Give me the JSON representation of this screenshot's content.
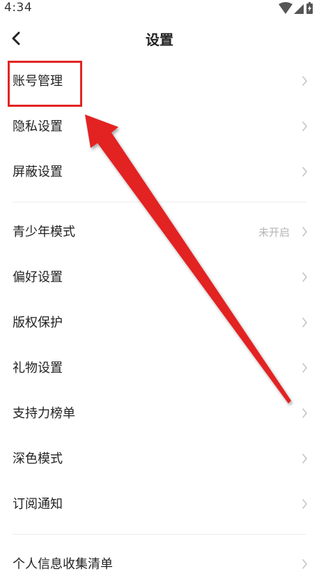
{
  "status_bar": {
    "time": "4:34"
  },
  "header": {
    "title": "设置"
  },
  "settings": {
    "group1": [
      {
        "label": "账号管理"
      },
      {
        "label": "隐私设置"
      },
      {
        "label": "屏蔽设置"
      }
    ],
    "group2": [
      {
        "label": "青少年模式",
        "value": "未开启"
      },
      {
        "label": "偏好设置"
      },
      {
        "label": "版权保护"
      },
      {
        "label": "礼物设置"
      },
      {
        "label": "支持力榜单"
      },
      {
        "label": "深色模式"
      },
      {
        "label": "订阅通知"
      }
    ],
    "group3": [
      {
        "label": "个人信息收集清单"
      }
    ]
  },
  "annotation": {
    "color": "#e32424",
    "target": "账号管理"
  },
  "icons": {
    "status": [
      "wifi-icon",
      "signal-icon",
      "battery-icon"
    ],
    "back": "chevron-left-icon",
    "row": "chevron-right-icon"
  }
}
